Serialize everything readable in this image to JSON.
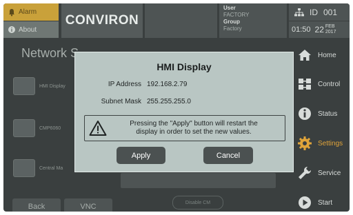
{
  "header": {
    "alarm_label": "Alarm",
    "about_label": "About",
    "brand": "CONVIRON",
    "user": {
      "user_label": "User",
      "user_value": "FACTORY",
      "group_label": "Group",
      "group_value": "Factory"
    },
    "id_label": "ID",
    "id_value": "001",
    "time": "01:50",
    "date_day": "22",
    "date_month": "FEB",
    "date_year": "2017"
  },
  "sidebar": {
    "items": [
      {
        "label": "Home",
        "icon": "home-icon"
      },
      {
        "label": "Control",
        "icon": "control-icon"
      },
      {
        "label": "Status",
        "icon": "info-icon"
      },
      {
        "label": "Settings",
        "icon": "gear-icon"
      },
      {
        "label": "Service",
        "icon": "wrench-icon"
      },
      {
        "label": "Start",
        "icon": "play-icon"
      }
    ],
    "active": "Settings"
  },
  "main": {
    "title": "Network S",
    "devices": [
      {
        "label": "HMI Display"
      },
      {
        "label": "CMP6060"
      },
      {
        "label": "Central Ma"
      }
    ],
    "back_label": "Back",
    "vnc_label": "VNC",
    "disable_cm_label": "Disable CM"
  },
  "modal": {
    "title": "HMI Display",
    "ip_label": "IP Address",
    "ip_value": "192.168.2.79",
    "mask_label": "Subnet Mask",
    "mask_value": "255.255.255.0",
    "warning_line1": "Pressing the \"Apply\" button will restart the",
    "warning_line2": "display in order to set the new values.",
    "apply_label": "Apply",
    "cancel_label": "Cancel"
  },
  "colors": {
    "accent_settings": "#e0a43a",
    "alarm": "#c9a13a",
    "modal_bg": "#b9c6c3",
    "modal_button": "#4b5151"
  }
}
